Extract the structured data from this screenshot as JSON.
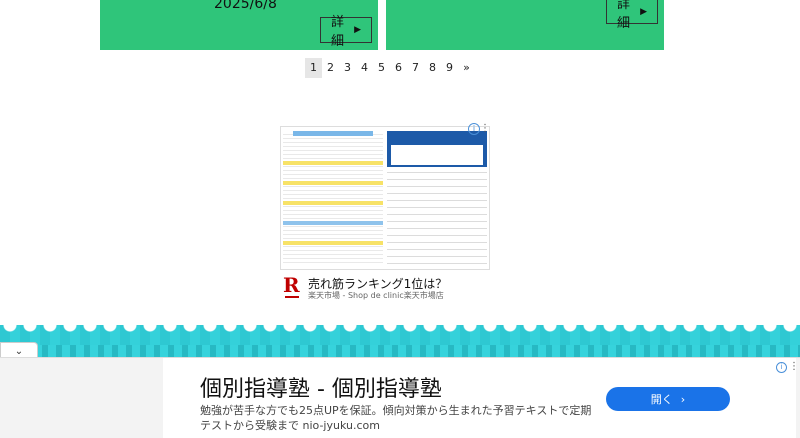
{
  "cards": [
    {
      "date": "2025/6/8",
      "detail_label": "詳細"
    },
    {
      "date": "",
      "detail_label": "詳細"
    }
  ],
  "pagination": {
    "pages": [
      "1",
      "2",
      "3",
      "4",
      "5",
      "6",
      "7",
      "8",
      "9"
    ],
    "next": "»",
    "current": "1"
  },
  "ad_block": {
    "headline": "売れ筋ランキング1位は？",
    "source": "楽天市場 - Shop de clinic楽天市場店",
    "logo_letter": "R",
    "info_icon": "i",
    "menu_icon": "⋮"
  },
  "bottom_ad": {
    "collapse_icon": "⌄",
    "title": "個別指導塾 - 個別指導塾",
    "desc_line1": "勉強が苦手な方でも25点UPを保証。傾向対策から生まれた予習テキストで定期",
    "desc_line2": "テストから受験まで nio-jyuku.com",
    "open_label": "開く",
    "open_arrow": "›",
    "info_icon": "i",
    "menu_icon": "⋮"
  },
  "colors": {
    "card_green": "#2fc57a",
    "wave_teal": "#2ec8d2",
    "button_blue": "#1a73e8",
    "rakuten_red": "#bf0000"
  }
}
